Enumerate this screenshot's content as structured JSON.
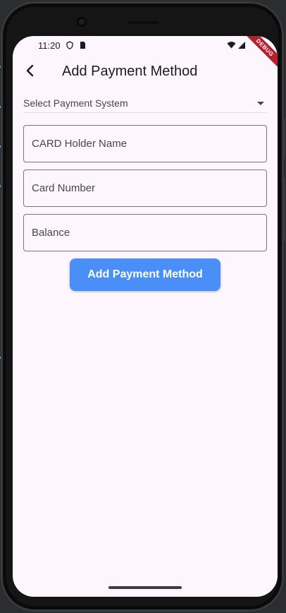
{
  "status_bar": {
    "time": "11:20",
    "debug_label": "DEBUG"
  },
  "app_bar": {
    "title": "Add Payment Method",
    "back_icon": "back-arrow-icon"
  },
  "form": {
    "payment_system_select": {
      "placeholder": "Select Payment System"
    },
    "fields": [
      {
        "label": "CARD Holder Name"
      },
      {
        "label": "Card Number"
      },
      {
        "label": "Balance"
      }
    ],
    "submit_label": "Add Payment Method"
  },
  "colors": {
    "background": "#fdf6fd",
    "button": "#4a8ff8",
    "button_text": "#ffffff",
    "border": "#79747e",
    "debug_ribbon": "#b3212c"
  }
}
